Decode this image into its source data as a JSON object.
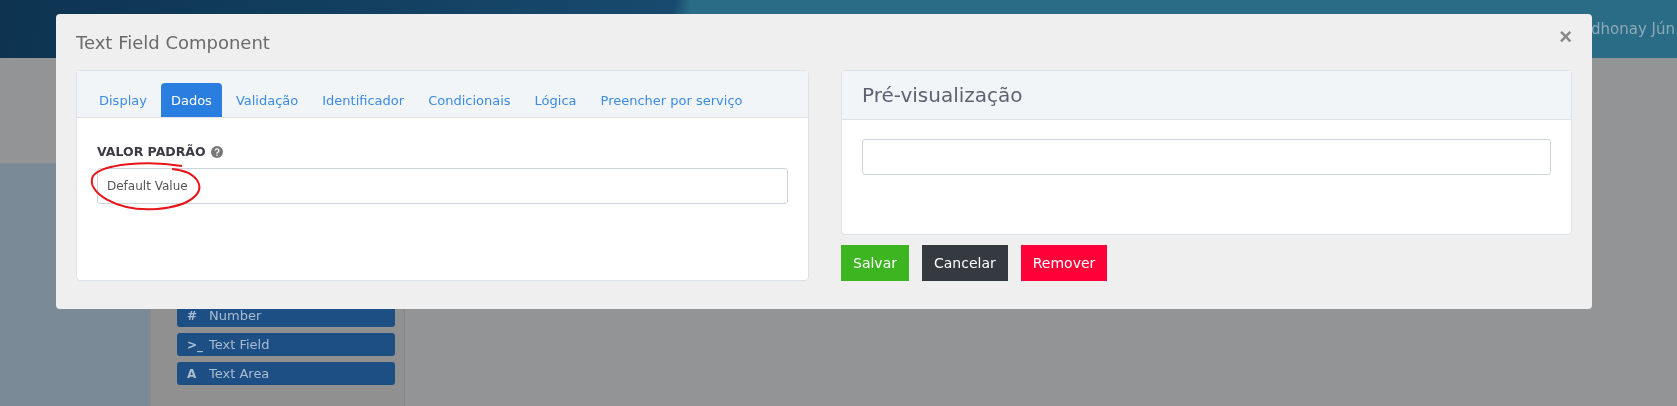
{
  "header": {
    "user_name": "dhonay Jún"
  },
  "palette": [
    {
      "icon": "#",
      "label": "Number"
    },
    {
      "icon": ">_",
      "label": "Text Field"
    },
    {
      "icon": "A",
      "label": "Text Area"
    }
  ],
  "modal": {
    "title": "Text Field Component",
    "close": "×",
    "tabs": [
      {
        "label": "Display",
        "selected": false
      },
      {
        "label": "Dados",
        "selected": true
      },
      {
        "label": "Validação",
        "selected": false
      },
      {
        "label": "Identificador",
        "selected": false
      },
      {
        "label": "Condicionais",
        "selected": false
      },
      {
        "label": "Lógica",
        "selected": false
      },
      {
        "label": "Preencher por serviço",
        "selected": false
      }
    ],
    "field_label": "VALOR PADRÃO",
    "field": {
      "placeholder": "Default Value",
      "annotated": true
    },
    "preview": {
      "title": "Pré-visualização"
    },
    "buttons": [
      {
        "label": "Salvar",
        "kind": "success"
      },
      {
        "label": "Cancelar",
        "kind": "dark"
      },
      {
        "label": "Remover",
        "kind": "danger"
      }
    ]
  }
}
